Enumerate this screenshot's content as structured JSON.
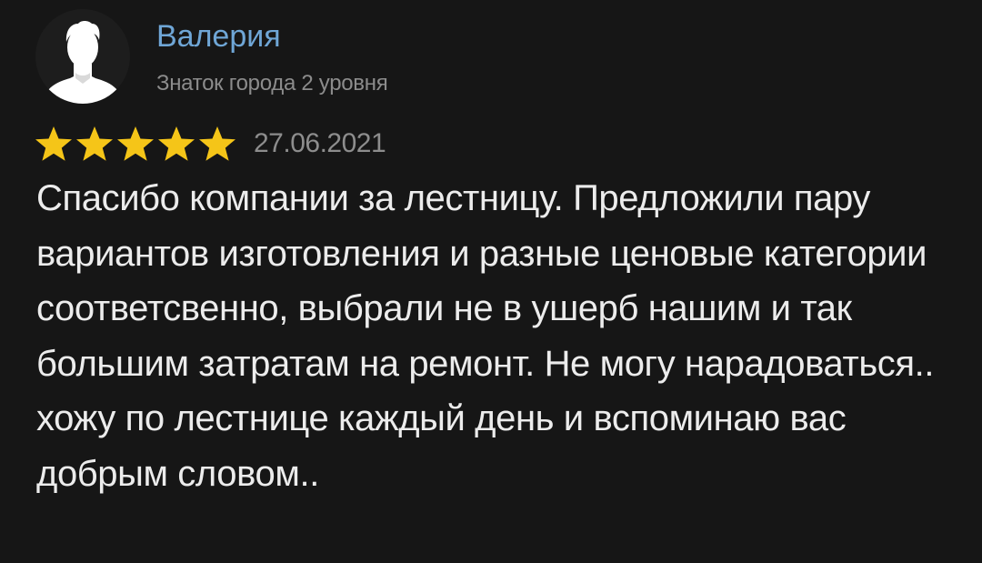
{
  "author": {
    "name": "Валерия",
    "level": "Знаток города 2 уровня",
    "avatar_icon": "user-silhouette-icon"
  },
  "rating": {
    "value": 5,
    "max": 5,
    "star_icon": "star-icon",
    "star_color": "#f5c518"
  },
  "review": {
    "date": "27.06.2021",
    "text": "Спасибо компании за лестницу. Предложили пару вариантов изготовления и разные ценовые категории соответсвенно, выбрали не в ушерб нашим и так большим затратам на ремонт. Не могу нарадоваться.. хожу по лестнице каждый день и вспоминаю вас добрым словом.."
  },
  "colors": {
    "background": "#161616",
    "author_name": "#6fa6d6",
    "secondary_text": "#8c8c8c",
    "body_text": "#ececec"
  }
}
